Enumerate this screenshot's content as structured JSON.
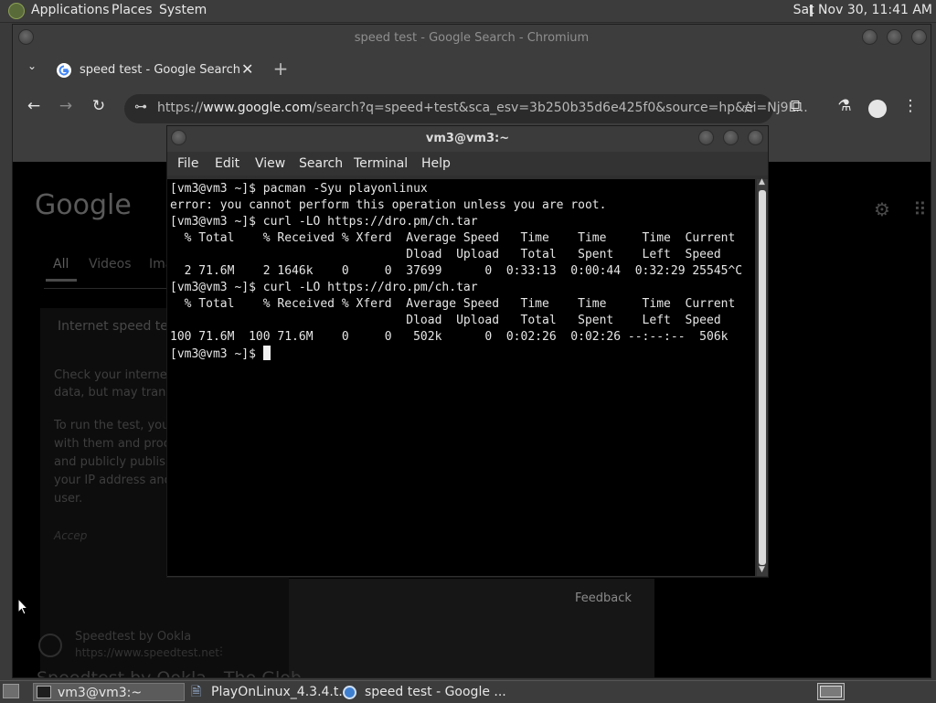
{
  "top_panel": {
    "menus": [
      "Applications",
      "Places",
      "System"
    ],
    "clock": "Sat Nov 30, 11:41 AM"
  },
  "chromium": {
    "window_title": "speed test - Google Search - Chromium",
    "tab_title": "speed test - Google Search",
    "url_scheme": "https://",
    "url_host": "www.google.com",
    "url_rest": "/search?q=speed+test&sca_esv=3b250b35d6e425f0&source=hp&ei=Nj9L...",
    "page": {
      "logo": "Google",
      "tabs": [
        "All",
        "Videos",
        "Ima"
      ],
      "card_title": "Internet speed te",
      "para1": [
        "Check your internet",
        "data, but may trans"
      ],
      "para2": [
        "To run the test, you'l",
        "with them and proce",
        "and publicly publish",
        "your IP address and",
        "user."
      ],
      "accept": "Accep",
      "feedback": "Feedback",
      "result_title": "Speedtest by Ookla",
      "result_url": "https://www.speedtest.net",
      "result_heading": "Speedtest by Ookla - The Glob"
    }
  },
  "terminal": {
    "title": "vm3@vm3:~",
    "menu": [
      "File",
      "Edit",
      "View",
      "Search",
      "Terminal",
      "Help"
    ],
    "lines": [
      "[vm3@vm3 ~]$ pacman -Syu playonlinux",
      "error: you cannot perform this operation unless you are root.",
      "[vm3@vm3 ~]$ curl -LO https://dro.pm/ch.tar",
      "  % Total    % Received % Xferd  Average Speed   Time    Time     Time  Current",
      "                                 Dload  Upload   Total   Spent    Left  Speed",
      "  2 71.6M    2 1646k    0     0  37699      0  0:33:13  0:00:44  0:32:29 25545^C",
      "[vm3@vm3 ~]$ curl -LO https://dro.pm/ch.tar",
      "  % Total    % Received % Xferd  Average Speed   Time    Time     Time  Current",
      "                                 Dload  Upload   Total   Spent    Left  Speed",
      "100 71.6M  100 71.6M    0     0   502k      0  0:02:26  0:02:26 --:--:--  506k"
    ],
    "prompt": "[vm3@vm3 ~]$ "
  },
  "taskbar": {
    "items": [
      "vm3@vm3:~",
      "PlayOnLinux_4.3.4.t...",
      "speed test - Google ..."
    ]
  },
  "colors": {
    "panel_bg": "#3c3c3c",
    "terminal_bg": "#000000",
    "chrome_toolbar": "#3d3d3d"
  }
}
